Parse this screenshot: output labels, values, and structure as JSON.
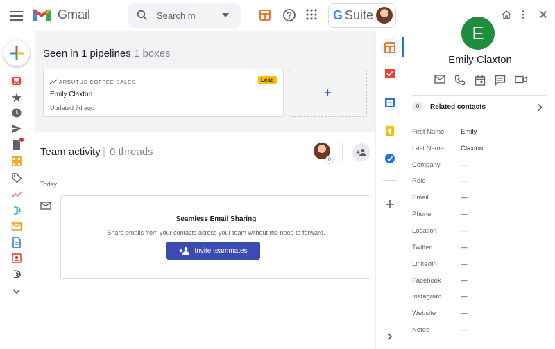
{
  "header": {
    "app_name": "Gmail",
    "search_placeholder": "Search m",
    "gsuite_g": "G",
    "gsuite_label": "Suite"
  },
  "pipelines": {
    "title": "Seen in 1 pipelines",
    "separator": "|",
    "boxes": "1 boxes",
    "box": {
      "pipeline": "ARBUTUS COFFEE SALES",
      "stage": "Lead",
      "name": "Emily Claxton",
      "updated": "Updated 7d ago"
    },
    "add_label": "+"
  },
  "team": {
    "title": "Team activity",
    "separator": "|",
    "threads": "0 threads",
    "avatar_count": "0",
    "today_label": "Today",
    "card": {
      "title": "Seamless Email Sharing",
      "description": "Share emails from your contacts across your team without the need to forward.",
      "button": "Invite teammates"
    }
  },
  "contact": {
    "initial": "E",
    "name": "Emily Claxton",
    "related_count": "0",
    "related_label": "Related contacts",
    "fields": [
      {
        "label": "First Name",
        "value": "Emily"
      },
      {
        "label": "Last Name",
        "value": "Claxton"
      },
      {
        "label": "Company",
        "value": "—"
      },
      {
        "label": "Role",
        "value": "—"
      },
      {
        "label": "Email",
        "value": "—"
      },
      {
        "label": "Phone",
        "value": "—"
      },
      {
        "label": "Location",
        "value": "—"
      },
      {
        "label": "Twitter",
        "value": "—"
      },
      {
        "label": "LinkedIn",
        "value": "—"
      },
      {
        "label": "Facebook",
        "value": "—"
      },
      {
        "label": "Instagram",
        "value": "—"
      },
      {
        "label": "Website",
        "value": "—"
      },
      {
        "label": "Notes",
        "value": "—"
      }
    ]
  },
  "colors": {
    "accent_blue": "#3c4bb2",
    "lead_badge": "#fbbc04",
    "avatar_green": "#1e8e3e",
    "gmail_red": "#ea4335"
  },
  "icons": {
    "rail": [
      "inbox-icon",
      "star-icon",
      "clock-icon",
      "send-icon",
      "draft-icon",
      "streak-grid-icon",
      "tag-icon",
      "trend-icon",
      "streak-logo-icon",
      "mail-icon",
      "document-icon",
      "contact-card-icon",
      "streak-logo-icon-2",
      "chevron-down-icon"
    ],
    "strip": [
      "streak-icon",
      "tasks-icon",
      "calendar-icon",
      "keep-icon",
      "check-icon",
      "plus-icon",
      "chevron-right-icon"
    ]
  }
}
